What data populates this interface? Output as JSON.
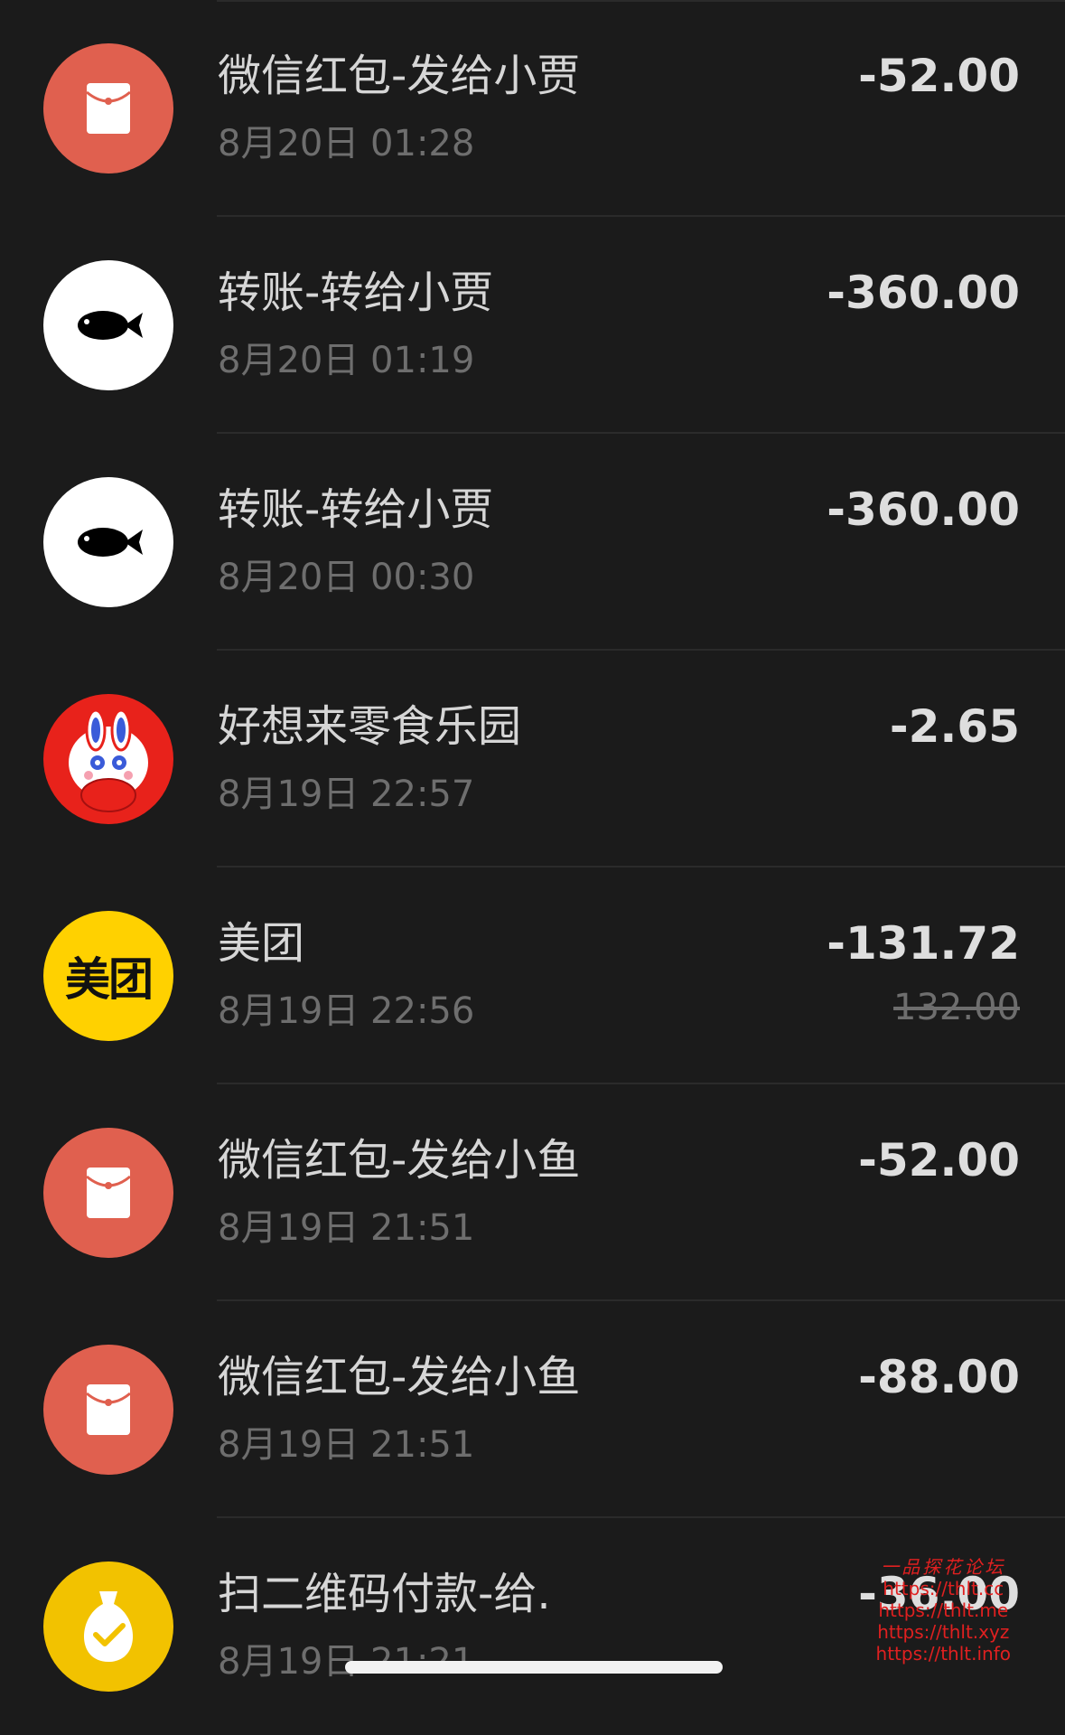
{
  "transactions": [
    {
      "title": "微信红包-发给小贾",
      "time": "8月20日 01:28",
      "amount": "-52.00",
      "icon": "red-envelope-icon",
      "icon_bg": "#e0604f"
    },
    {
      "title": "转账-转给小贾",
      "time": "8月20日 01:19",
      "amount": "-360.00",
      "icon": "fish-avatar-icon",
      "icon_bg": "#ffffff"
    },
    {
      "title": "转账-转给小贾",
      "time": "8月20日 00:30",
      "amount": "-360.00",
      "icon": "fish-avatar-icon",
      "icon_bg": "#ffffff"
    },
    {
      "title": "好想来零食乐园",
      "time": "8月19日 22:57",
      "amount": "-2.65",
      "icon": "rabbit-mascot-icon",
      "icon_bg": "#e8221b"
    },
    {
      "title": "美团",
      "time": "8月19日 22:56",
      "amount": "-131.72",
      "original_amount": "132.00",
      "icon": "meituan-logo-icon",
      "icon_text": "美团",
      "icon_bg": "#ffd100"
    },
    {
      "title": "微信红包-发给小鱼",
      "time": "8月19日 21:51",
      "amount": "-52.00",
      "icon": "red-envelope-icon",
      "icon_bg": "#e0604f"
    },
    {
      "title": "微信红包-发给小鱼",
      "time": "8月19日 21:51",
      "amount": "-88.00",
      "icon": "red-envelope-icon",
      "icon_bg": "#e0604f"
    },
    {
      "title": "扫二维码付款-给.",
      "time": "8月19日 21:21",
      "amount": "-36.00",
      "icon": "money-bag-icon",
      "icon_bg": "#f2c200"
    }
  ],
  "watermark": {
    "title": "一品探花论坛",
    "lines": [
      "https://thlt.cc",
      "https://thlt.me",
      "https://thlt.xyz",
      "https://thlt.info"
    ]
  },
  "colors": {
    "background": "#1b1b1b",
    "divider": "#2b2b2b",
    "title_text": "#d6d6d6",
    "secondary_text": "#6e6e6e",
    "watermark": "#e02020"
  }
}
